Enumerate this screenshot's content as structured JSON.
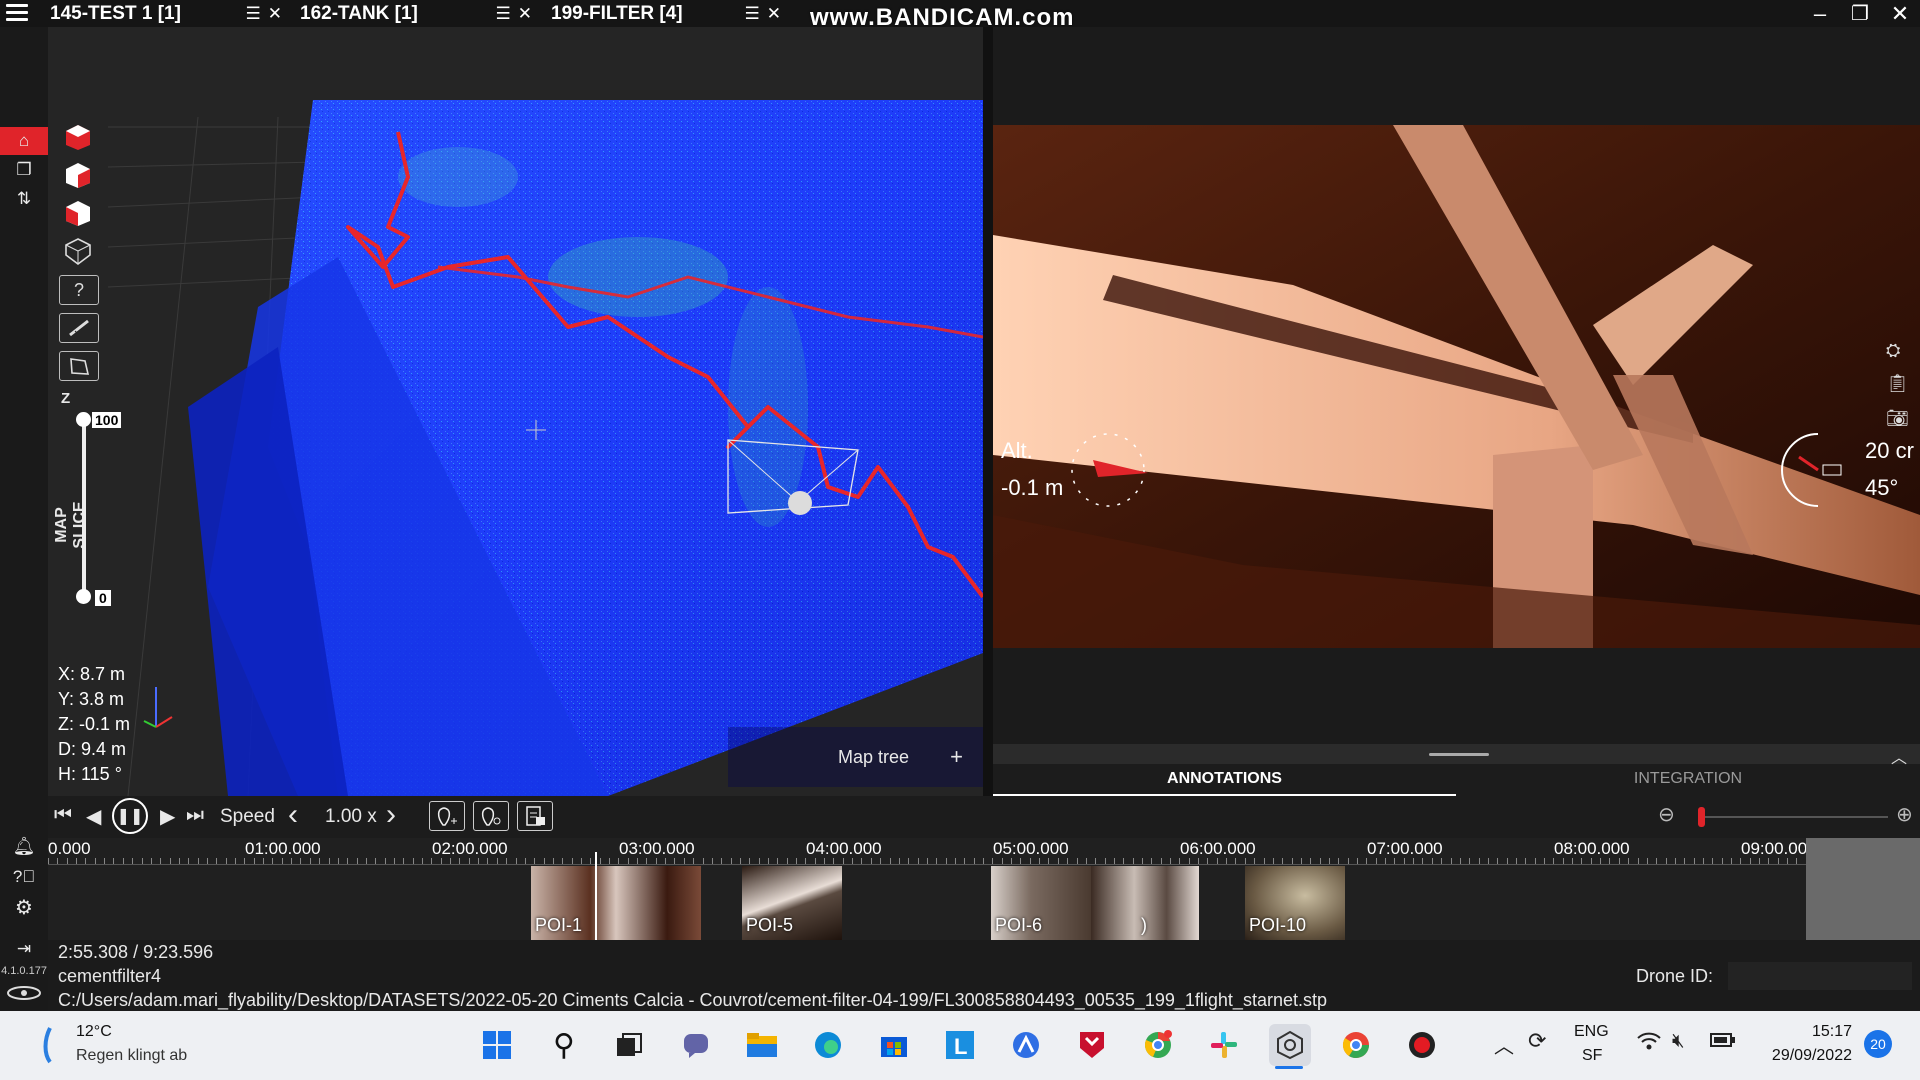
{
  "titlebar": {
    "tabs": [
      {
        "label": "145-TEST 1 [1]"
      },
      {
        "label": "162-TANK [1]"
      },
      {
        "label": "199-FILTER [4]"
      }
    ],
    "watermark": "www.BANDICAM.com"
  },
  "tools": {
    "help_label": "?"
  },
  "map_slice": {
    "label": "MAP SLICE",
    "axis": "Z",
    "top_value": "100",
    "bottom_value": "0"
  },
  "coordinates": {
    "x": "X:  8.7 m",
    "y": "Y:  3.8 m",
    "z": "Z:  -0.1 m",
    "d": "D:  9.4 m",
    "h": "H:   115 °"
  },
  "map_tree": {
    "label": "Map tree",
    "add": "+"
  },
  "camera": {
    "alt_label": "Alt.",
    "alt_value": "-0.1 m",
    "distance": "20 cr",
    "angle": "45°"
  },
  "panel": {
    "tabs": [
      {
        "label": "ANNOTATIONS",
        "active": true
      },
      {
        "label": "INTEGRATION",
        "active": false
      }
    ]
  },
  "playback": {
    "speed_label": "Speed",
    "speed_value": "1.00 x"
  },
  "timeline": {
    "ticks": [
      "0.000",
      "01:00.000",
      "02:00.000",
      "03:00.000",
      "04:00.000",
      "05:00.000",
      "06:00.000",
      "07:00.000",
      "08:00.000",
      "09:00.000"
    ],
    "pois": [
      {
        "label": "POI-1"
      },
      {
        "label": "POI-5"
      },
      {
        "label": "POI-6"
      },
      {
        "label": ")"
      },
      {
        "label": "POI-10"
      }
    ],
    "progress": 0.311
  },
  "info": {
    "time": "2:55.308 / 9:23.596",
    "name": "cementfilter4",
    "path": "C:/Users/adam.mari_flyability/Desktop/DATASETS/2022-05-20 Ciments Calcia - Couvrot/cement-filter-04-199/FL300858804493_00535_199_1flight_starnet.stp",
    "drone_label": "Drone ID:",
    "version": "4.1.0.177"
  },
  "taskbar": {
    "weather_temp": "12°C",
    "weather_desc": "Regen klingt ab",
    "lang1": "ENG",
    "lang2": "SF",
    "time": "15:17",
    "date": "29/09/2022",
    "badge": "20"
  }
}
